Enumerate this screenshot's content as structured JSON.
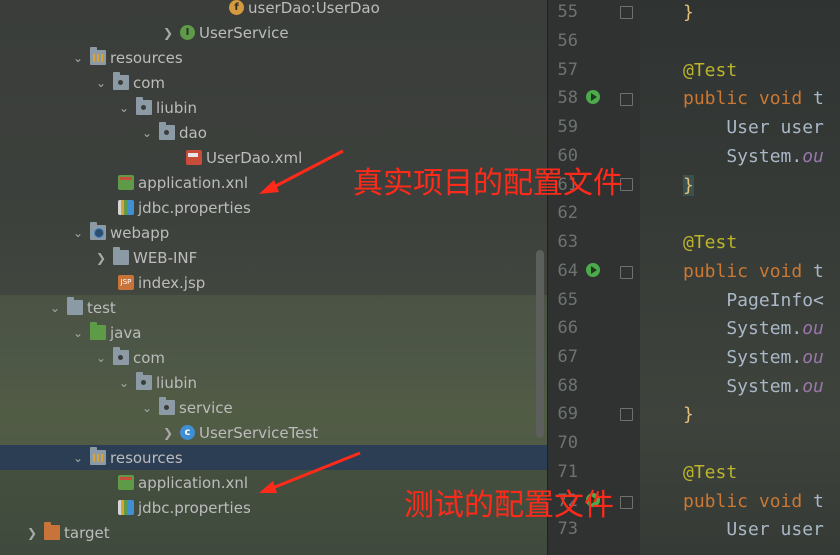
{
  "project_tree": {
    "rows": [
      {
        "label": "userDao:UserDao",
        "icon": "field-icon"
      },
      {
        "label": "UserService",
        "icon": "interface-icon"
      },
      {
        "label": "resources",
        "icon": "resources-folder-icon"
      },
      {
        "label": "com",
        "icon": "package-icon"
      },
      {
        "label": "liubin",
        "icon": "package-icon"
      },
      {
        "label": "dao",
        "icon": "package-icon"
      },
      {
        "label": "UserDao.xml",
        "icon": "xml-file-icon"
      },
      {
        "label": "application.xnl",
        "icon": "xml-config-file-icon"
      },
      {
        "label": "jdbc.properties",
        "icon": "properties-file-icon"
      },
      {
        "label": "webapp",
        "icon": "web-folder-icon"
      },
      {
        "label": "WEB-INF",
        "icon": "folder-icon"
      },
      {
        "label": "index.jsp",
        "icon": "jsp-file-icon"
      },
      {
        "label": "test",
        "icon": "folder-icon"
      },
      {
        "label": "java",
        "icon": "test-source-folder-icon"
      },
      {
        "label": "com",
        "icon": "package-icon"
      },
      {
        "label": "liubin",
        "icon": "package-icon"
      },
      {
        "label": "service",
        "icon": "package-icon"
      },
      {
        "label": "UserServiceTest",
        "icon": "test-class-icon"
      },
      {
        "label": "resources",
        "icon": "test-resources-folder-icon"
      },
      {
        "label": "application.xnl",
        "icon": "xml-config-file-icon"
      },
      {
        "label": "jdbc.properties",
        "icon": "properties-file-icon"
      },
      {
        "label": "target",
        "icon": "excluded-folder-icon"
      }
    ]
  },
  "editor": {
    "line_numbers": [
      "55",
      "56",
      "57",
      "58",
      "59",
      "60",
      "61",
      "62",
      "63",
      "64",
      "65",
      "66",
      "67",
      "68",
      "69",
      "70",
      "71",
      "72",
      "73"
    ],
    "lines": {
      "l55": "}",
      "l57": "@Test",
      "l58_kw": "public void",
      "l58_rest": " t",
      "l59": "    User user",
      "l60_a": "    System.",
      "l60_b": "ou",
      "l61": "}",
      "l63": "@Test",
      "l64_kw": "public void",
      "l64_rest": " t",
      "l65": "    PageInfo<",
      "l66_a": "    System.",
      "l66_b": "ou",
      "l67_a": "    System.",
      "l67_b": "ou",
      "l68_a": "    System.",
      "l68_b": "ou",
      "l69": "}",
      "l71": "@Test",
      "l72_kw": "public void",
      "l72_rest": " t",
      "l73": "    User user"
    }
  },
  "annotations": {
    "real_config": "真实项目的配置文件",
    "test_config": "测试的配置文件",
    "color": "#ff2a1a"
  },
  "colors": {
    "keyword": "#cc7832",
    "annotation": "#bbb529",
    "field": "#9876aa",
    "selection": "#2c3e54"
  }
}
